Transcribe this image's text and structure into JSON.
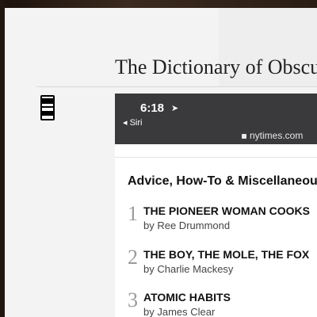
{
  "page": {
    "title": "The Dictionary of Obscure Sorrows"
  },
  "icons": {
    "document": "document-icon",
    "location": "location-arrow-icon",
    "lock": "lock-icon",
    "back": "back-arrow-icon"
  },
  "phone": {
    "time": "6:18",
    "location_arrow": "➤",
    "back_label": "◂ Siri",
    "url": "nytimes.com",
    "section_heading": "Advice, How-To & Miscellaneous",
    "books": [
      {
        "rank": "1",
        "title": "THE PIONEER WOMAN COOKS",
        "author": "by Ree Drummond"
      },
      {
        "rank": "2",
        "title": "THE BOY, THE MOLE, THE FOX",
        "author": "by Charlie Mackesy"
      },
      {
        "rank": "3",
        "title": "ATOMIC HABITS",
        "author": "by James Clear"
      }
    ]
  }
}
